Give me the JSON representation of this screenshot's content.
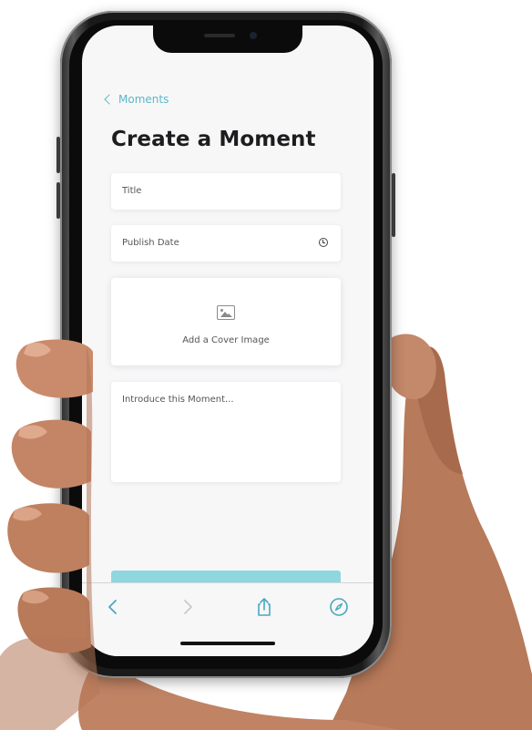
{
  "nav": {
    "back_label": "Moments"
  },
  "page": {
    "title": "Create a Moment"
  },
  "form": {
    "title_placeholder": "Title",
    "publish_date_placeholder": "Publish Date",
    "cover_label": "Add a Cover Image",
    "intro_placeholder": "Introduce this Moment..."
  },
  "toolbar": {
    "back_icon": "chevron-left-icon",
    "forward_icon": "chevron-right-icon",
    "share_icon": "share-icon",
    "compass_icon": "compass-icon"
  },
  "colors": {
    "accent": "#5bb8c8",
    "submit_button": "#8fd7df",
    "screen_background": "#f7f7f8"
  }
}
